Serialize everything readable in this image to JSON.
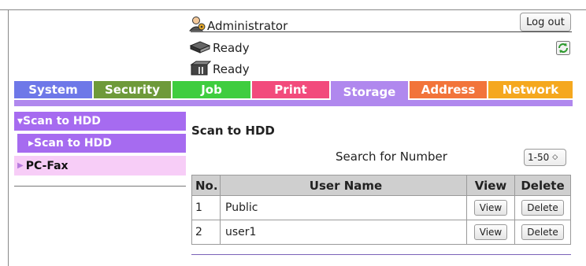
{
  "header": {
    "user_label": "Administrator",
    "logout_label": "Log out",
    "status": [
      "Ready",
      "Ready"
    ]
  },
  "tabs": [
    {
      "label": "System",
      "color": "#6e78e8"
    },
    {
      "label": "Security",
      "color": "#6e9a3a"
    },
    {
      "label": "Job",
      "color": "#3fcd3f"
    },
    {
      "label": "Print",
      "color": "#f24b7c"
    },
    {
      "label": "Storage",
      "color": "#b088ee",
      "active": true
    },
    {
      "label": "Address",
      "color": "#f2743a"
    },
    {
      "label": "Network",
      "color": "#f5a81f"
    }
  ],
  "sidebar": {
    "scan_to_hdd": "▾Scan to HDD",
    "scan_to_hdd_sub": "▸Scan to HDD",
    "pc_fax": "PC-Fax"
  },
  "main": {
    "title": "Scan to HDD",
    "search_label": "Search for Number",
    "search_value": "1-50",
    "columns": {
      "no": "No.",
      "user_name": "User Name",
      "view": "View",
      "delete": "Delete"
    },
    "rows": [
      {
        "no": "1",
        "name": "Public",
        "view": "View",
        "delete": "Delete"
      },
      {
        "no": "2",
        "name": "user1",
        "view": "View",
        "delete": "Delete"
      }
    ]
  }
}
